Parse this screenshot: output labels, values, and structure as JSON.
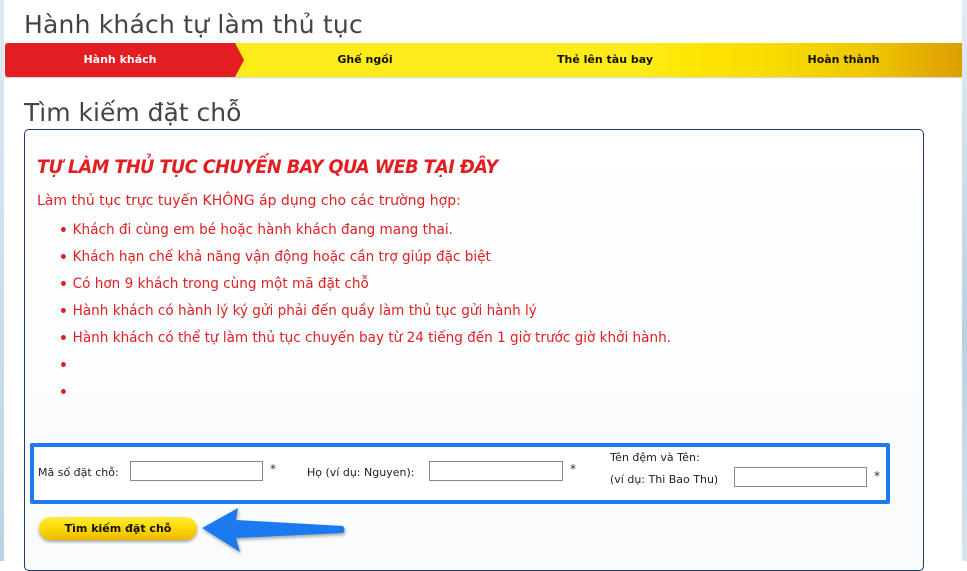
{
  "page": {
    "title": "Hành khách tự làm thủ tục"
  },
  "steps": [
    {
      "label": "Hành khách",
      "active": true
    },
    {
      "label": "Ghế ngồi",
      "active": false
    },
    {
      "label": "Thẻ lên tàu bay",
      "active": false
    },
    {
      "label": "Hoàn thành",
      "active": false
    }
  ],
  "section": {
    "title": "Tìm kiếm đặt chỗ"
  },
  "notice": {
    "heading": "TỰ LÀM THỦ TỤC CHUYẾN BAY QUA WEB TẠI ĐÂY",
    "intro": "Làm thủ tục trực tuyến KHÔNG áp dụng cho các trường hợp:",
    "items": [
      "Khách đi cùng em bé hoặc hành khách đang mang thai.",
      "Khách hạn chế khả năng vận động hoặc cần trợ giúp đặc biệt",
      "Có hơn 9 khách trong cùng một mã đặt chỗ",
      "Hành khách có hành lý ký gửi phải đến quầy làm thủ tục gửi hành lý",
      "Hành khách có thể tự làm thủ tục chuyến bay từ 24 tiếng đến 1 giờ trước giờ khởi hành.",
      "",
      ""
    ]
  },
  "form": {
    "booking_code": {
      "label": "Mã số đặt chỗ:",
      "value": "",
      "required_mark": "*"
    },
    "last_name": {
      "label": "Họ (ví dụ: Nguyen):",
      "value": "",
      "required_mark": "*"
    },
    "first_name": {
      "label_line1": "Tên đệm và Tên:",
      "label_line2": "(ví dụ: Thi Bao Thu)",
      "value": "",
      "required_mark": "*"
    },
    "submit_label": "Tìm kiếm đặt chỗ"
  },
  "colors": {
    "accent_red": "#e21e22",
    "step_yellow": "#fdec1a",
    "highlight_blue": "#1f7af0",
    "button_yellow": "#fbd800"
  }
}
